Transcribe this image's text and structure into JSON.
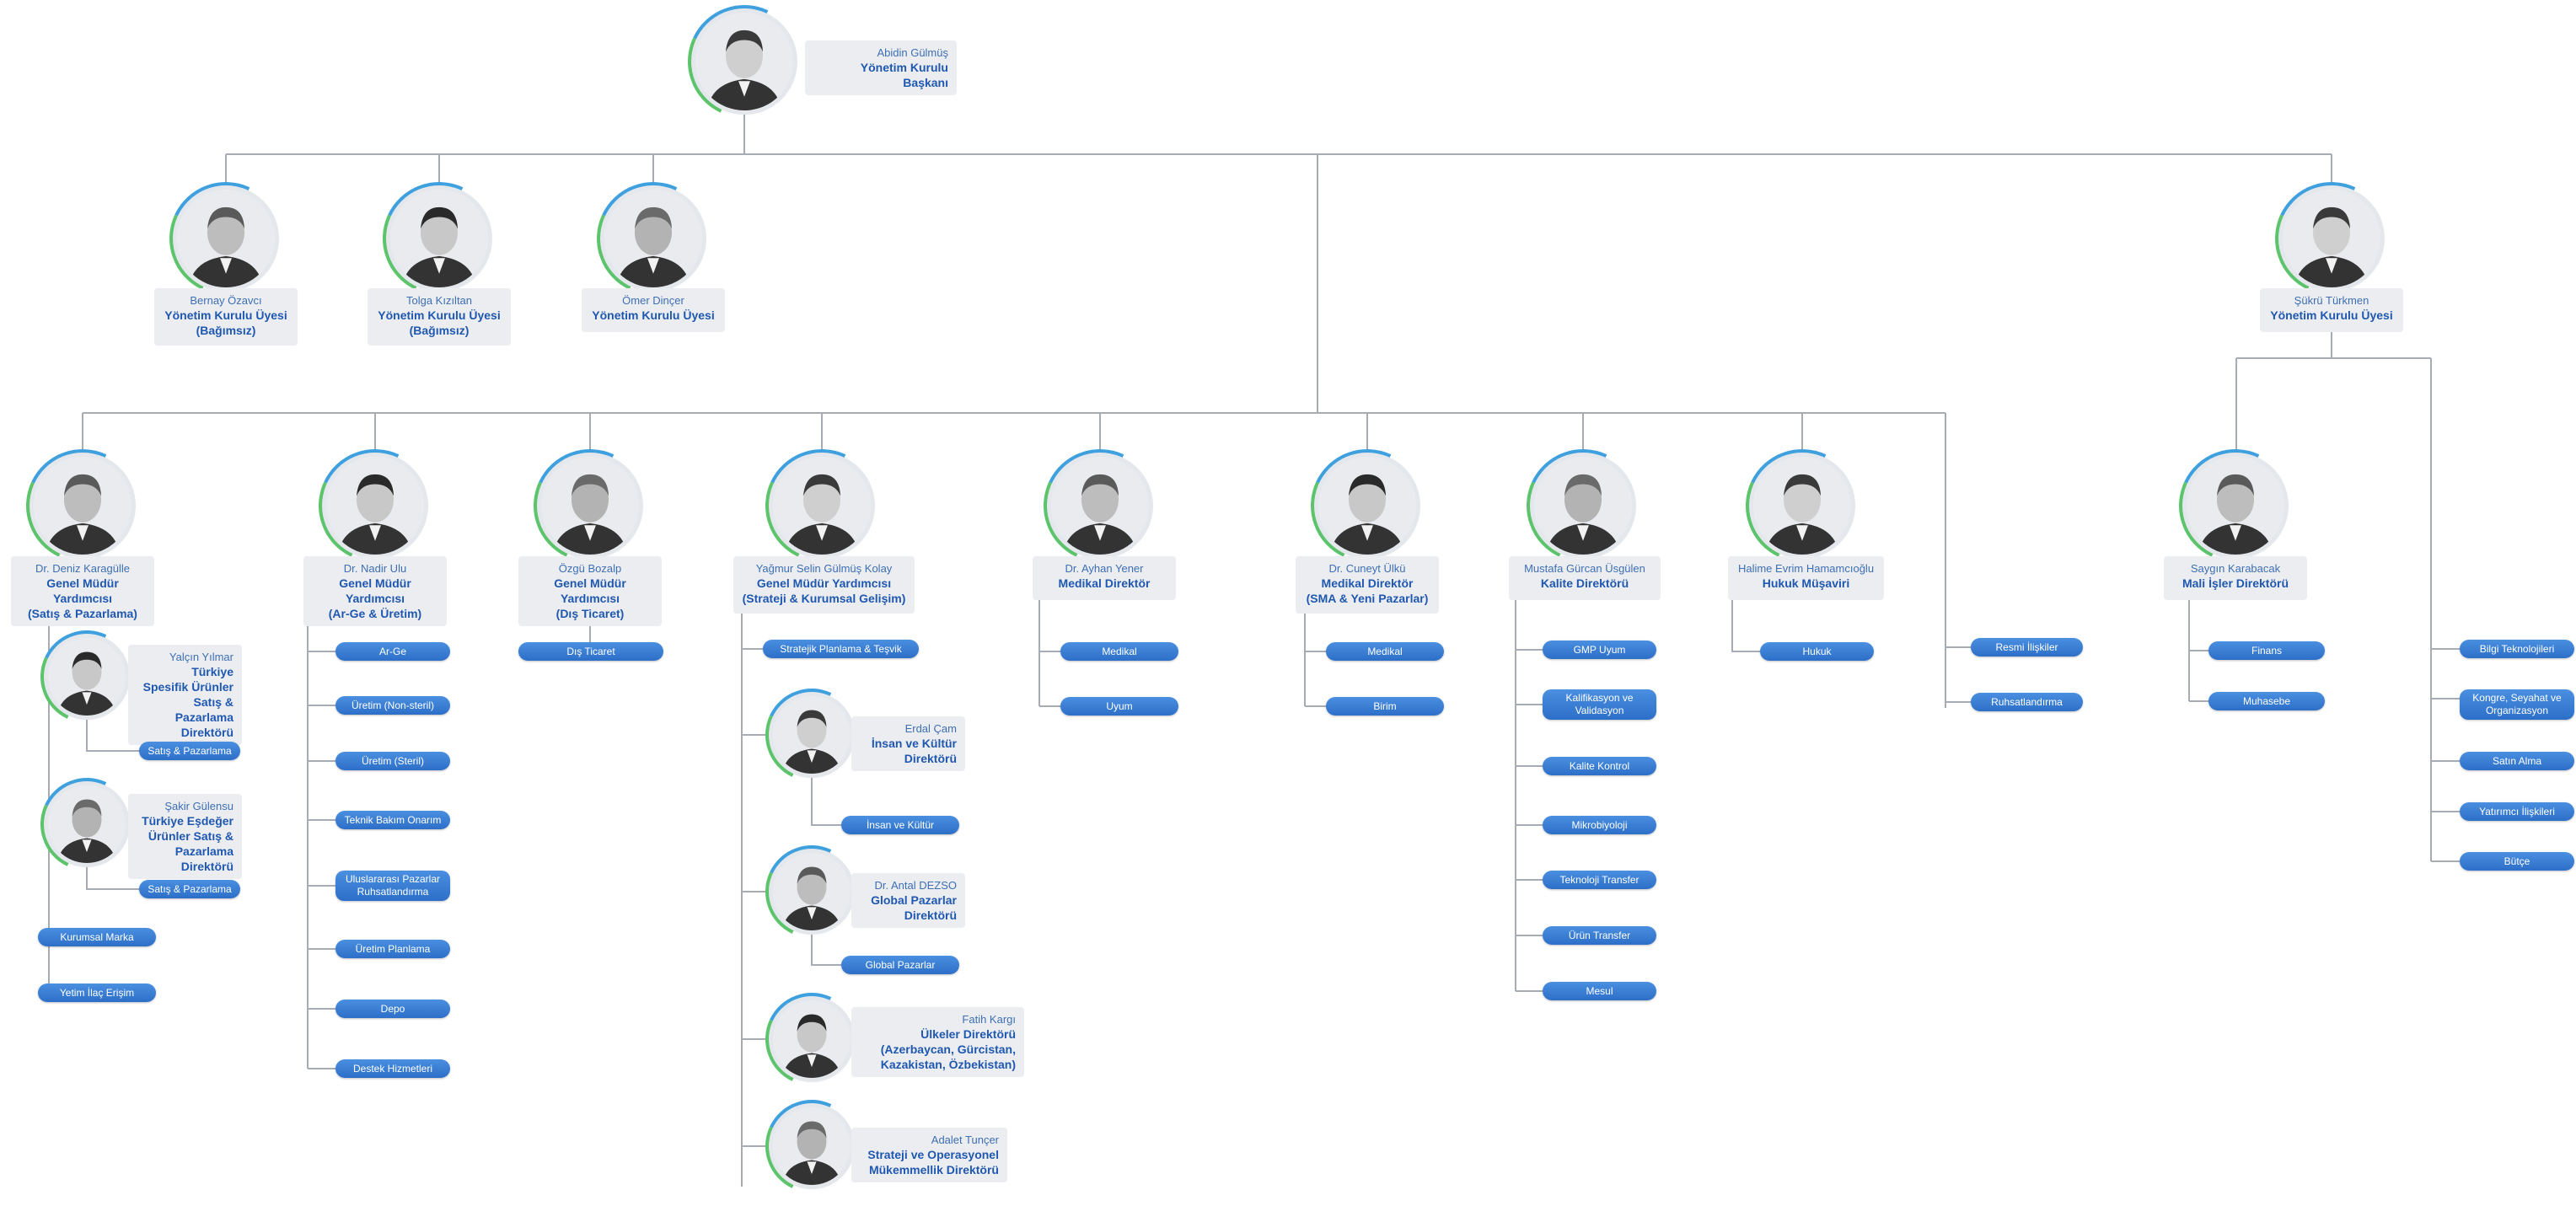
{
  "people": [
    {
      "id": "gulmus",
      "name": "Abidin Gülmüş",
      "title": "Yönetim Kurulu Başkanı",
      "layout": "side"
    },
    {
      "id": "ozavci",
      "name": "Bernay Özavcı",
      "title": "Yönetim Kurulu Üyesi\n(Bağımsız)",
      "layout": "below"
    },
    {
      "id": "kiziltan",
      "name": "Tolga Kızıltan",
      "title": "Yönetim Kurulu Üyesi\n(Bağımsız)",
      "layout": "below"
    },
    {
      "id": "dincer",
      "name": "Ömer Dinçer",
      "title": "Yönetim Kurulu Üyesi",
      "layout": "below"
    },
    {
      "id": "turkmen",
      "name": "Şükrü Türkmen",
      "title": "Yönetim Kurulu Üyesi",
      "layout": "below"
    },
    {
      "id": "karagulle",
      "name": "Dr. Deniz Karagülle",
      "title": "Genel Müdür Yardımcısı\n(Satış & Pazarlama)",
      "layout": "below"
    },
    {
      "id": "ulu",
      "name": "Dr. Nadir Ulu",
      "title": "Genel Müdür Yardımcısı\n(Ar-Ge & Üretim)",
      "layout": "below"
    },
    {
      "id": "bozalp",
      "name": "Özgü Bozalp",
      "title": "Genel Müdür Yardımcısı\n(Dış Ticaret)",
      "layout": "below"
    },
    {
      "id": "kolay",
      "name": "Yağmur Selin Gülmüş Kolay",
      "title": "Genel Müdür Yardımcısı\n(Strateji & Kurumsal Gelişim)",
      "layout": "below"
    },
    {
      "id": "yener",
      "name": "Dr. Ayhan Yener",
      "title": "Medikal Direktör",
      "layout": "below"
    },
    {
      "id": "ulku",
      "name": "Dr. Cuneyt Ülkü",
      "title": "Medikal Direktör\n(SMA & Yeni Pazarlar)",
      "layout": "below"
    },
    {
      "id": "usgulen",
      "name": "Mustafa Gürcan Üsgülen",
      "title": "Kalite Direktörü",
      "layout": "below"
    },
    {
      "id": "hamamcioglu",
      "name": "Halime Evrim Hamamcıoğlu",
      "title": "Hukuk Müşaviri",
      "layout": "below"
    },
    {
      "id": "karabacak",
      "name": "Saygın Karabacak",
      "title": "Mali İşler Direktörü",
      "layout": "below"
    },
    {
      "id": "yilmar",
      "name": "Yalçın Yılmar",
      "title": "Türkiye\nSpesifik Ürünler\nSatış & Pazarlama\nDirektörü",
      "layout": "side"
    },
    {
      "id": "gulensu",
      "name": "Şakir Gülensu",
      "title": "Türkiye Eşdeğer\nÜrünler Satış &\nPazarlama\nDirektörü",
      "layout": "side"
    },
    {
      "id": "cam",
      "name": "Erdal Çam",
      "title": "İnsan ve Kültür\nDirektörü",
      "layout": "side"
    },
    {
      "id": "dezso",
      "name": "Dr. Antal DEZSO",
      "title": "Global Pazarlar\nDirektörü",
      "layout": "side"
    },
    {
      "id": "kargi",
      "name": "Fatih Kargı",
      "title": "Ülkeler Direktörü\n(Azerbaycan, Gürcistan,\nKazakistan, Özbekistan)",
      "layout": "side"
    },
    {
      "id": "tuncer",
      "name": "Adalet Tunçer",
      "title": "Strateji ve Operasyonel\nMükemmellik Direktörü",
      "layout": "side"
    }
  ],
  "units": {
    "satis1": "Satış & Pazarlama",
    "satis2": "Satış & Pazarlama",
    "kurumsal_marka": "Kurumsal Marka",
    "yetim_ilac": "Yetim İlaç Erişim",
    "arge": "Ar-Ge",
    "uretim_nonsteril": "Üretim (Non-steril)",
    "uretim_steril": "Üretim (Steril)",
    "teknik_bakim": "Teknik Bakım Onarım",
    "uluslararasi": "Uluslararası Pazarlar\nRuhsatlandırma",
    "uretim_planlama": "Üretim Planlama",
    "depo": "Depo",
    "destek": "Destek Hizmetleri",
    "dis_ticaret": "Dış Ticaret",
    "stratejik": "Stratejik Planlama & Teşvik",
    "insan_kultur": "İnsan ve Kültür",
    "global_pazarlar": "Global Pazarlar",
    "medikal1": "Medikal",
    "uyum": "Uyum",
    "medikal2": "Medikal",
    "birim": "Birim",
    "gmp": "GMP Uyum",
    "kalifikasyon": "Kalifikasyon ve\nValidasyon",
    "kalite_kontrol": "Kalite Kontrol",
    "mikrobiyoloji": "Mikrobiyoloji",
    "teknoloji_transfer": "Teknoloji Transfer",
    "urun_transfer": "Ürün Transfer",
    "mesul": "Mesul",
    "hukuk": "Hukuk",
    "resmi": "Resmi İlişkiler",
    "ruhsat": "Ruhsatlandırma",
    "finans": "Finans",
    "muhasebe": "Muhasebe",
    "bilgi": "Bilgi Teknolojileri",
    "kongre": "Kongre, Seyahat ve\nOrganizasyon",
    "satin_alma": "Satın Alma",
    "yatirimci": "Yatırımcı İlişkileri",
    "butce": "Bütçe"
  }
}
